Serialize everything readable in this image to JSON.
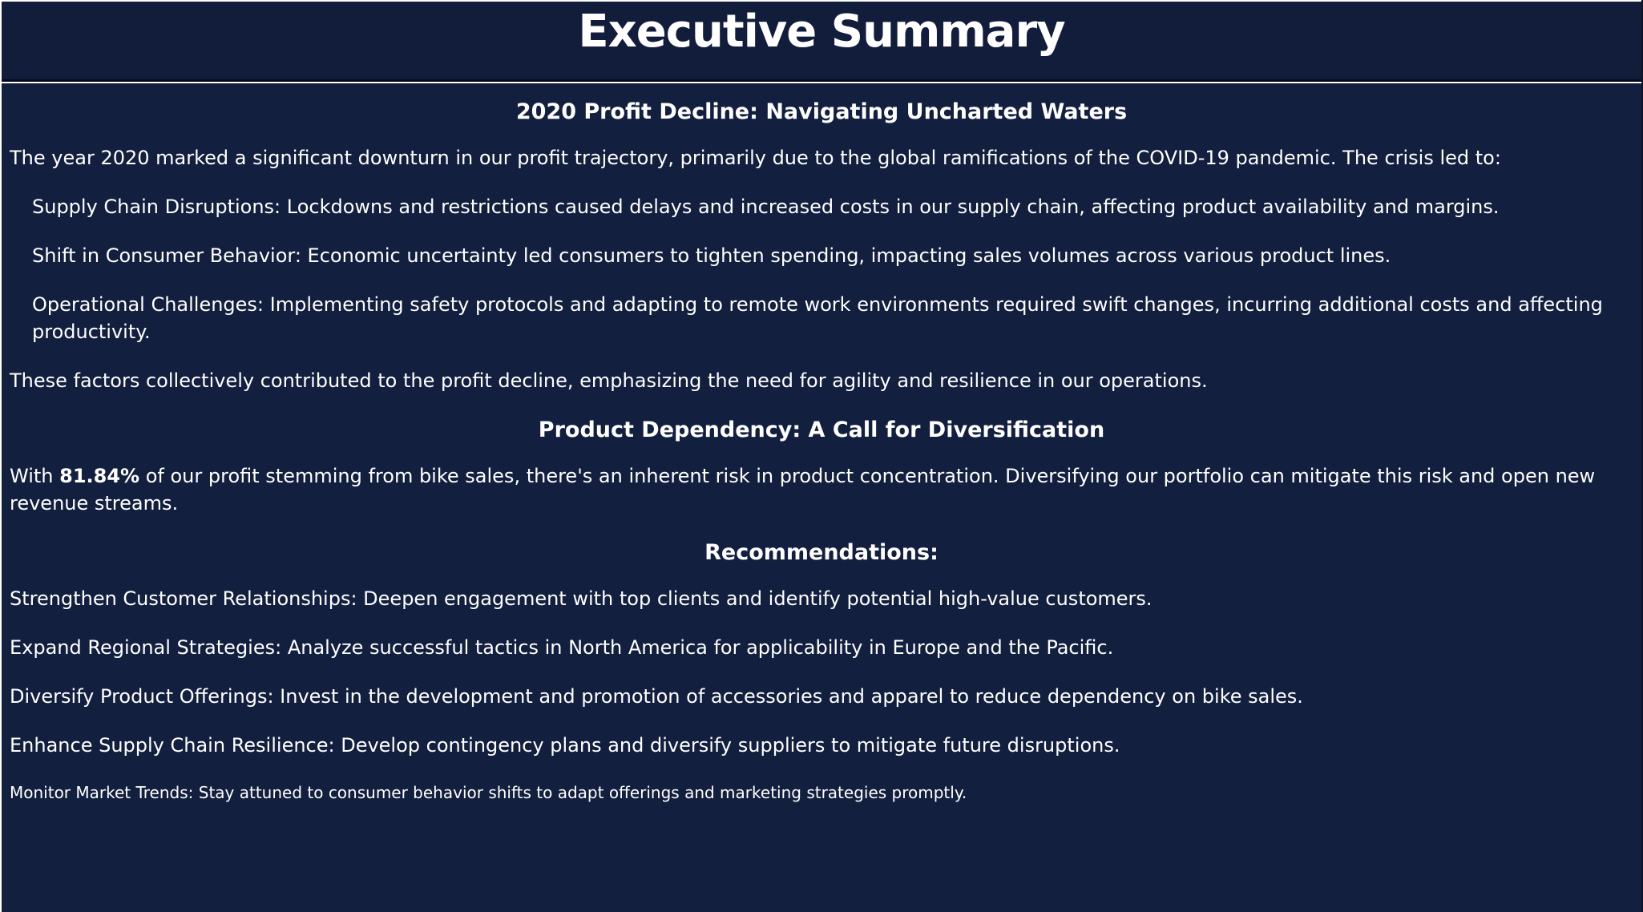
{
  "header": {
    "title": "Executive Summary"
  },
  "section_profit_decline": {
    "heading": "2020 Profit Decline: Navigating Uncharted Waters",
    "intro": "The year 2020 marked a significant downturn in our profit trajectory, primarily due to the global ramifications of the COVID-19 pandemic. The crisis led to:",
    "factors": [
      "Supply Chain Disruptions: Lockdowns and restrictions caused delays and increased costs in our supply chain, affecting product availability and margins.",
      "Shift in Consumer Behavior: Economic uncertainty led consumers to tighten spending, impacting sales volumes across various product lines.",
      "Operational Challenges: Implementing safety protocols and adapting to remote work environments required swift changes, incurring additional costs and affecting productivity."
    ],
    "conclusion": "These factors collectively contributed to the profit decline, emphasizing the need for agility and resilience in our operations."
  },
  "section_product_dependency": {
    "heading": "Product Dependency: A Call for Diversification",
    "text_before": "With ",
    "highlight": "81.84%",
    "text_after": " of our profit stemming from bike sales, there's an inherent risk in product concentration. Diversifying our portfolio can mitigate this risk and open new revenue streams."
  },
  "section_recommendations": {
    "heading": "Recommendations:",
    "items": [
      "Strengthen Customer Relationships: Deepen engagement with top clients and identify potential high-value customers.",
      "Expand Regional Strategies: Analyze successful tactics in North America for applicability in Europe and the Pacific.",
      "Diversify Product Offerings: Invest in the development and promotion of accessories and apparel to reduce dependency on bike sales.",
      "Enhance Supply Chain Resilience: Develop contingency plans and diversify suppliers to mitigate future disruptions.",
      "Monitor Market Trends: Stay attuned to consumer behavior shifts to adapt offerings and marketing strategies promptly."
    ]
  },
  "colors": {
    "header_background": "#111d3a",
    "panel_background": "#131f3e",
    "text": "#ffffff",
    "page_background": "#ffffff"
  }
}
